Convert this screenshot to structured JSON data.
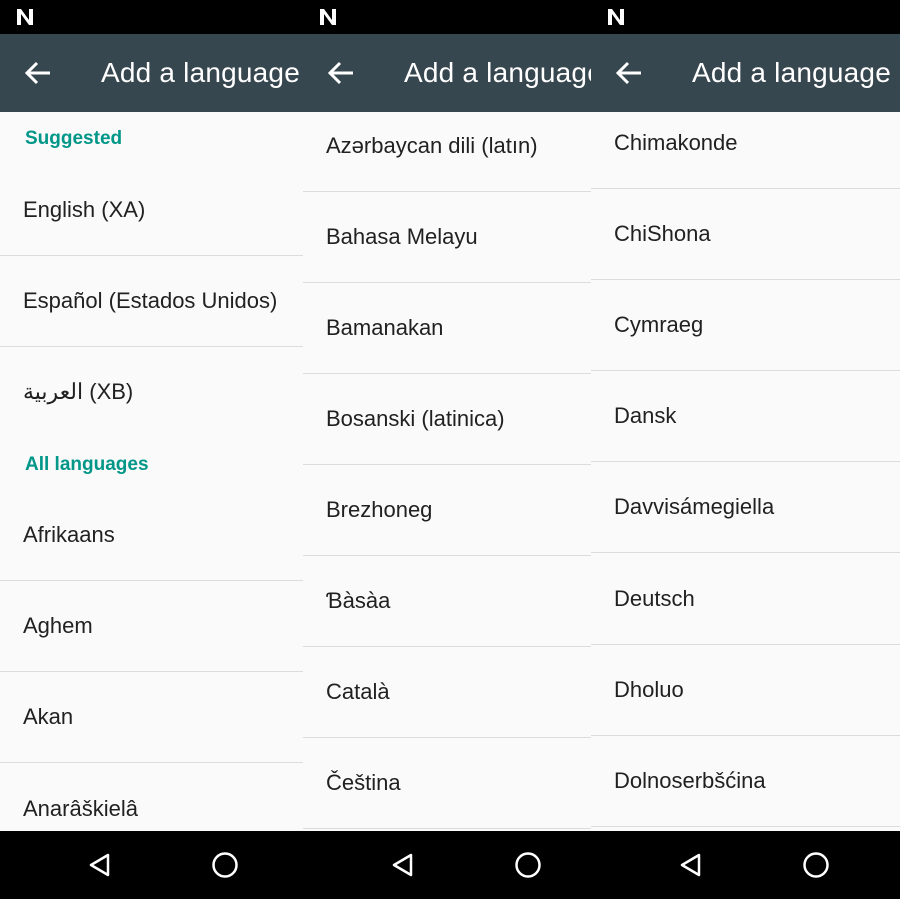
{
  "app_bar": {
    "title": "Add a language"
  },
  "panel1": {
    "suggested_header": "Suggested",
    "suggested": [
      "English (XA)",
      "Español (Estados Unidos)",
      "العربية (XB)"
    ],
    "all_header": "All languages",
    "languages": [
      "Afrikaans",
      "Aghem",
      "Akan",
      "Anarâškielâ"
    ]
  },
  "panel2": {
    "languages": [
      "Azərbaycan dili (latın)",
      "Bahasa Melayu",
      "Bamanakan",
      "Bosanski (latinica)",
      "Brezhoneg",
      "Ɓàsàa",
      "Català",
      "Čeština"
    ]
  },
  "panel3": {
    "languages": [
      "Chimakonde",
      "ChiShona",
      "Cymraeg",
      "Dansk",
      "Davvisámegiella",
      "Deutsch",
      "Dholuo",
      "Dolnoserbšćina"
    ]
  },
  "colors": {
    "app_bar": "#37474f",
    "accent": "#009688",
    "list_bg": "#fafafa",
    "text": "#212121"
  },
  "icons": {
    "status": "notification-n-icon",
    "back": "back-arrow-icon",
    "nav_back": "nav-back-icon",
    "nav_home": "nav-home-icon"
  }
}
